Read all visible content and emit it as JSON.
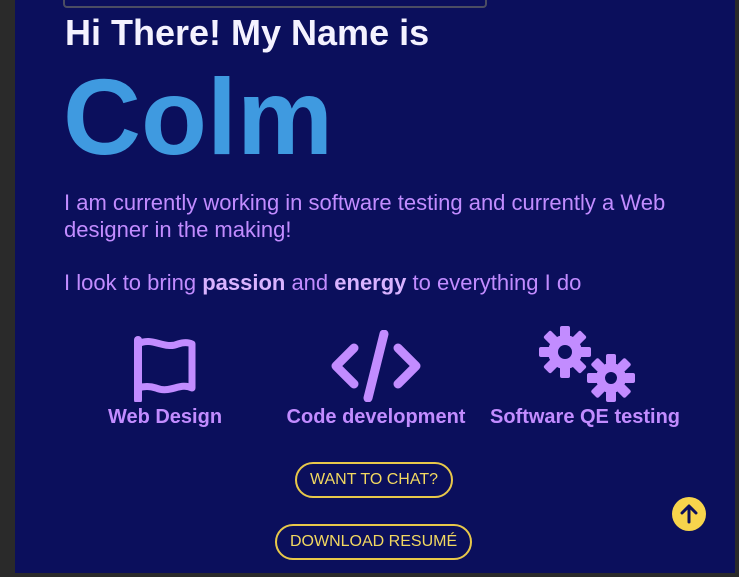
{
  "hero": {
    "greeting": "Hi There! My Name is",
    "name": "Colm",
    "intro": "I am currently working in software testing and currently a Web designer in the making!",
    "motto_prefix": "I look to bring ",
    "motto_bold1": "passion",
    "motto_middle": " and ",
    "motto_bold2": "energy",
    "motto_suffix": " to everything I do"
  },
  "skills": [
    {
      "label": "Web Design",
      "icon": "flag-icon"
    },
    {
      "label": "Code development",
      "icon": "code-icon"
    },
    {
      "label": "Software QE testing",
      "icon": "gears-icon"
    }
  ],
  "buttons": {
    "chat": "WANT TO CHAT?",
    "resume": "DOWNLOAD RESUMÉ",
    "scroll_top_icon": "arrow-up-icon"
  },
  "colors": {
    "background": "#0b0f5c",
    "name_blue": "#3f9ae0",
    "text_purple": "#c28cff",
    "accent_yellow": "#f2d860"
  }
}
